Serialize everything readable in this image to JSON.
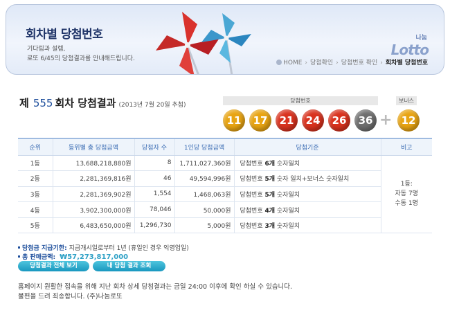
{
  "banner": {
    "title": "회차별 당첨번호",
    "subtitle1": "기다림과 설렘,",
    "subtitle2": "로또 6/45의 당첨결과를 안내해드립니다.",
    "logo_small": "나눔",
    "logo_big": "Lotto"
  },
  "breadcrumb": {
    "items": [
      "HOME",
      "당첨확인",
      "당첨번호 확인",
      "회차별 당첨번호"
    ]
  },
  "round": {
    "prefix": "제",
    "number": "555",
    "suffix": "회차 당첨결과",
    "date": "(2013년 7월 20일 추첨)"
  },
  "winning": {
    "label": "당첨번호",
    "bonus_label": "보너스",
    "numbers": [
      "11",
      "17",
      "21",
      "24",
      "26",
      "36"
    ],
    "bonus": "12",
    "colors": {
      "yellow": "#e8a412",
      "blue": "#1f56b5",
      "red": "#d9321e",
      "gray": "#6e6e6e"
    }
  },
  "table": {
    "headers": [
      "순위",
      "등위별 총 당첨금액",
      "당첨자 수",
      "1인당 당첨금액",
      "당첨기준",
      "비고"
    ],
    "rows": [
      {
        "rank": "1등",
        "total": "13,688,218,880원",
        "winners": "8",
        "per": "1,711,027,360원",
        "crit_a": "당첨번호 ",
        "crit_b": "6개",
        "crit_c": " 숫자일치"
      },
      {
        "rank": "2등",
        "total": "2,281,369,816원",
        "winners": "46",
        "per": "49,594,996원",
        "crit_a": "당첨번호 ",
        "crit_b": "5개",
        "crit_c": " 숫자 일치+보너스 숫자일치"
      },
      {
        "rank": "3등",
        "total": "2,281,369,902원",
        "winners": "1,554",
        "per": "1,468,063원",
        "crit_a": "당첨번호 ",
        "crit_b": "5개",
        "crit_c": " 숫자일치"
      },
      {
        "rank": "4등",
        "total": "3,902,300,000원",
        "winners": "78,046",
        "per": "50,000원",
        "crit_a": "당첨번호 ",
        "crit_b": "4개",
        "crit_c": " 숫자일치"
      },
      {
        "rank": "5등",
        "total": "6,483,650,000원",
        "winners": "1,296,730",
        "per": "5,000원",
        "crit_a": "당첨번호 ",
        "crit_b": "3개",
        "crit_c": " 숫자일치"
      }
    ],
    "note_line1": "1등:",
    "note_line2": "자동 7명",
    "note_line3": "수동 1명"
  },
  "info": {
    "deadline_label": "당첨금 지급기한:",
    "deadline_value": "지급개시일로부터 1년 (휴일인 경우 익영업일)",
    "sales_label": "총 판매금액:",
    "sales_value": "₩57,273,817,000"
  },
  "buttons": {
    "full_results": "당첨결과 전체 보기",
    "my_results": "내 당첨 결과 조회"
  },
  "notice": {
    "line1": "홈페이지 원활한 접속을 위해 지난 회차 상세 당첨결과는 금일 24:00 이후에 확인 하실 수 있습니다.",
    "line2": "불편을 드려 죄송합니다. (주)나눔로또"
  }
}
